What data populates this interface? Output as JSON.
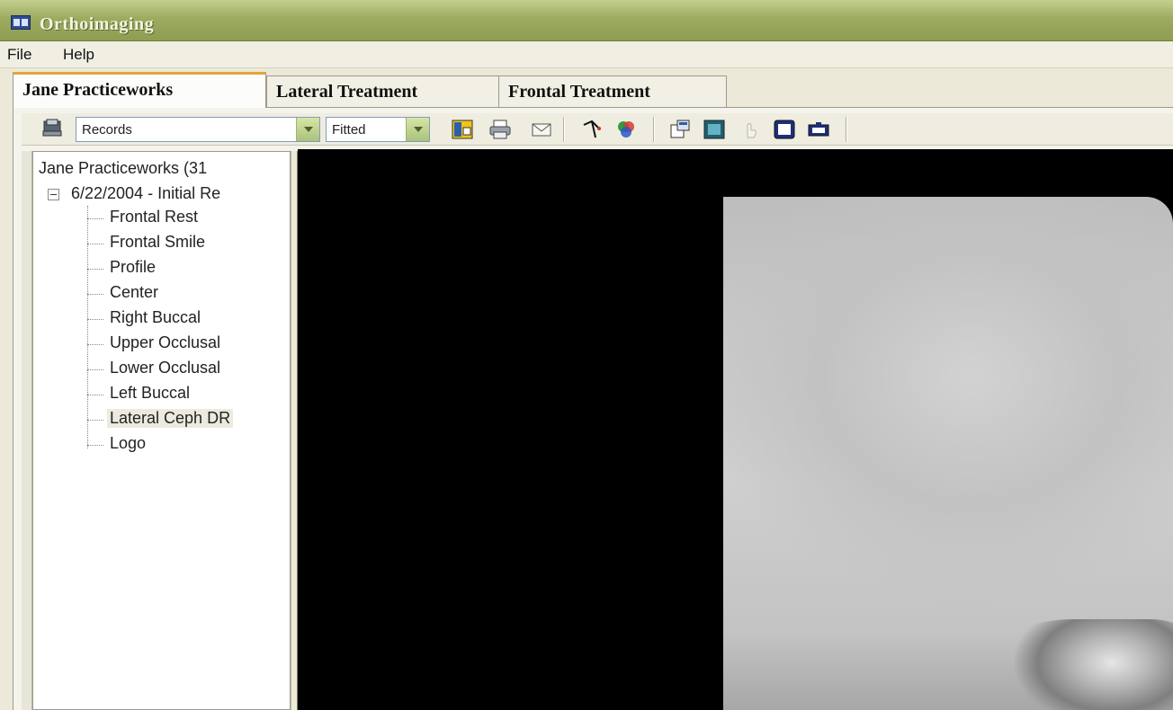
{
  "window": {
    "title": "Orthoimaging"
  },
  "menu": {
    "items": [
      "File",
      "Help"
    ]
  },
  "tabs": [
    {
      "label": "Jane Practiceworks",
      "active": true
    },
    {
      "label": "Lateral Treatment",
      "active": false
    },
    {
      "label": "Frontal Treatment",
      "active": false
    }
  ],
  "toolbar": {
    "records_value": "Records",
    "fit_value": "Fitted",
    "icons": [
      "records-icon",
      "layout-icon",
      "print-icon",
      "email-icon",
      "measure-icon",
      "colors-icon",
      "properties-icon",
      "image-icon",
      "touch-icon",
      "screen-icon",
      "mailbox-icon"
    ]
  },
  "tree": {
    "root": "Jane Practiceworks (31",
    "date_node": "6/22/2004 - Initial Re",
    "items": [
      "Frontal Rest",
      "Frontal Smile",
      "Profile",
      "Center",
      "Right Buccal",
      "Upper Occlusal",
      "Lower Occlusal",
      "Left Buccal",
      "Lateral Ceph DR",
      "Logo"
    ],
    "selected": "Lateral Ceph DR"
  },
  "colors": {
    "title_bar": "#9cab5f",
    "active_tab_accent": "#e2a53b",
    "viewer_bg": "#000000"
  }
}
